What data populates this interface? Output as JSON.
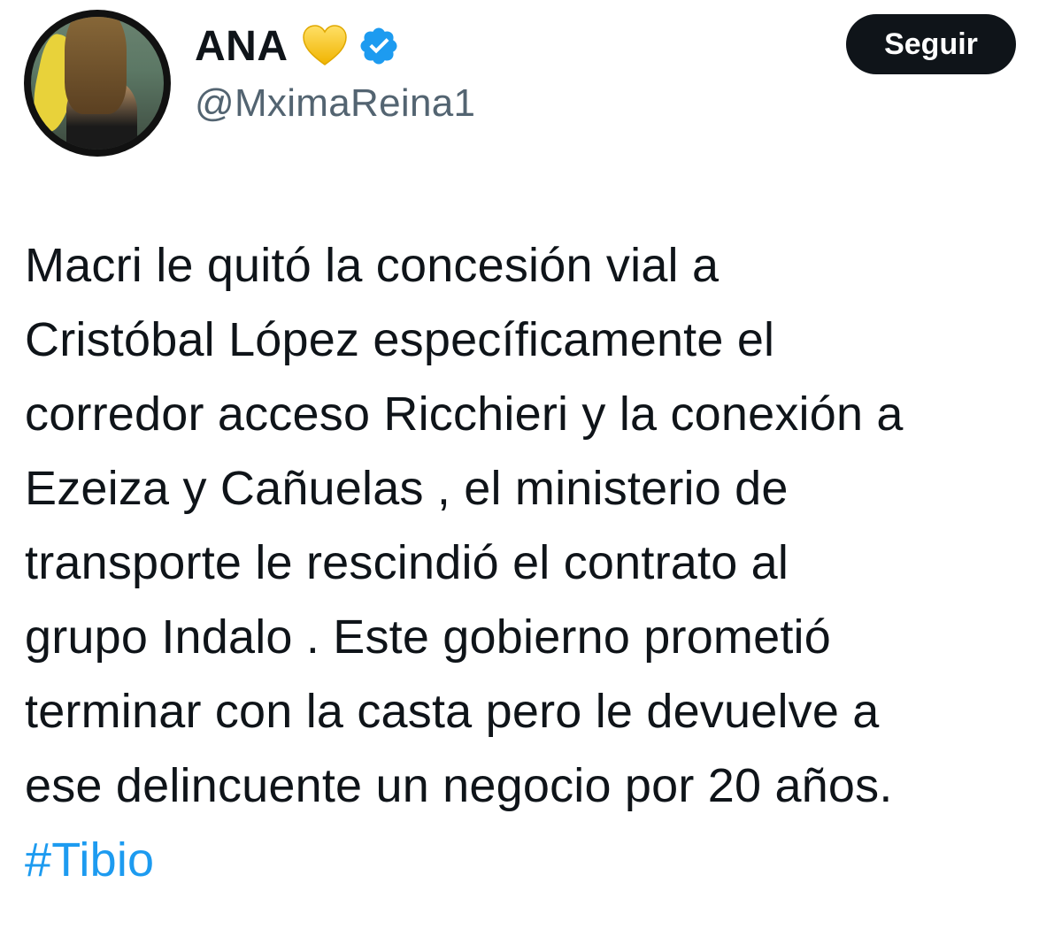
{
  "author": {
    "display_name": "ANA",
    "handle": "@MximaReina1",
    "badges": [
      "yellow-heart-icon",
      "verified-badge-icon"
    ]
  },
  "actions": {
    "follow_label": "Seguir"
  },
  "tweet": {
    "lines": [
      "Macri le quitó la concesión vial a",
      "Cristóbal López específicamente el",
      "corredor acceso Ricchieri y la conexión a",
      "Ezeiza y Cañuelas , el ministerio de",
      "transporte le rescindió el contrato al",
      "grupo Indalo . Este gobierno  prometió",
      "terminar con la casta pero le devuelve a",
      "ese delincuente un negocio por 20 años."
    ],
    "hashtag": "#Tibio"
  },
  "colors": {
    "text": "#0f1419",
    "secondary": "#536471",
    "link": "#1d9bf0",
    "verified": "#1d9bf0",
    "heart": "#f5c518",
    "button_bg": "#0f1419",
    "button_text": "#ffffff"
  }
}
